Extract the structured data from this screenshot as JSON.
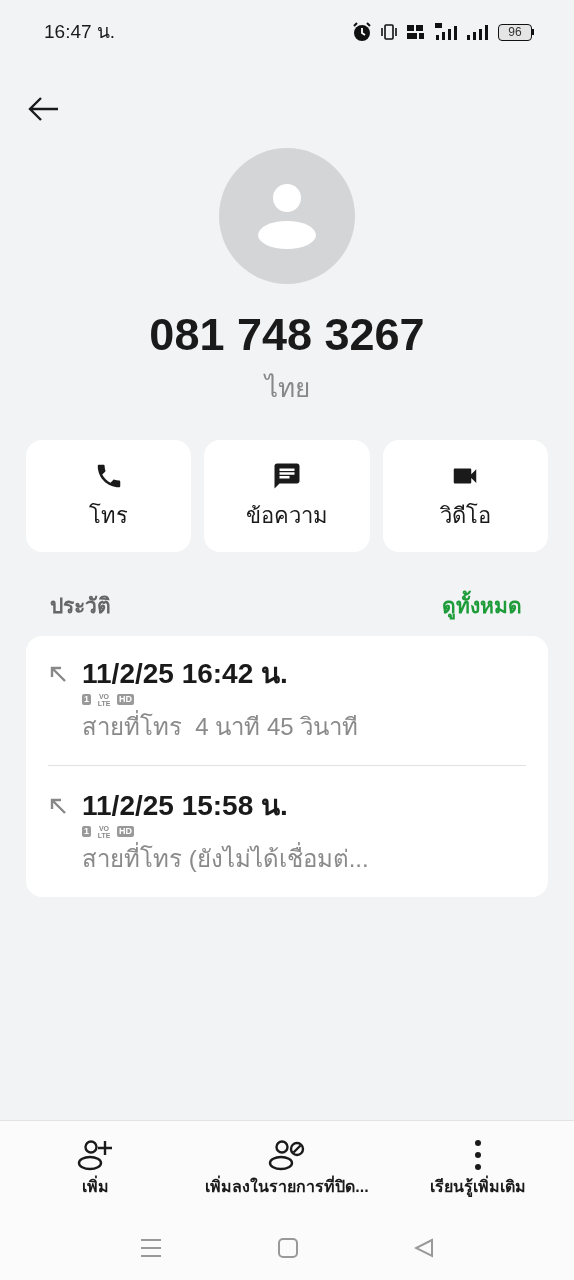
{
  "status_bar": {
    "time": "16:47 น.",
    "battery": "96"
  },
  "contact": {
    "number": "081 748 3267",
    "location": "ไทย"
  },
  "actions": [
    {
      "kind": "call",
      "label": "โทร"
    },
    {
      "kind": "message",
      "label": "ข้อความ"
    },
    {
      "kind": "video",
      "label": "วิดีโอ"
    }
  ],
  "history": {
    "title": "ประวัติ",
    "see_all": "ดูทั้งหมด",
    "entries": [
      {
        "datetime": "11/2/25 16:42 น.",
        "badges": [
          "1",
          "VO LTE",
          "HD"
        ],
        "detail": "สายที่โทร  4 นาที 45 วินาที"
      },
      {
        "datetime": "11/2/25 15:58 น.",
        "badges": [
          "1",
          "VO LTE",
          "HD"
        ],
        "detail": "สายที่โทร (ยังไม่ได้เชื่อมต่..."
      }
    ]
  },
  "bottom_actions": [
    {
      "kind": "add",
      "label": "เพิ่ม"
    },
    {
      "kind": "block",
      "label": "เพิ่มลงในรายการที่ปิด..."
    },
    {
      "kind": "more",
      "label": "เรียนรู้เพิ่มเติม"
    }
  ]
}
